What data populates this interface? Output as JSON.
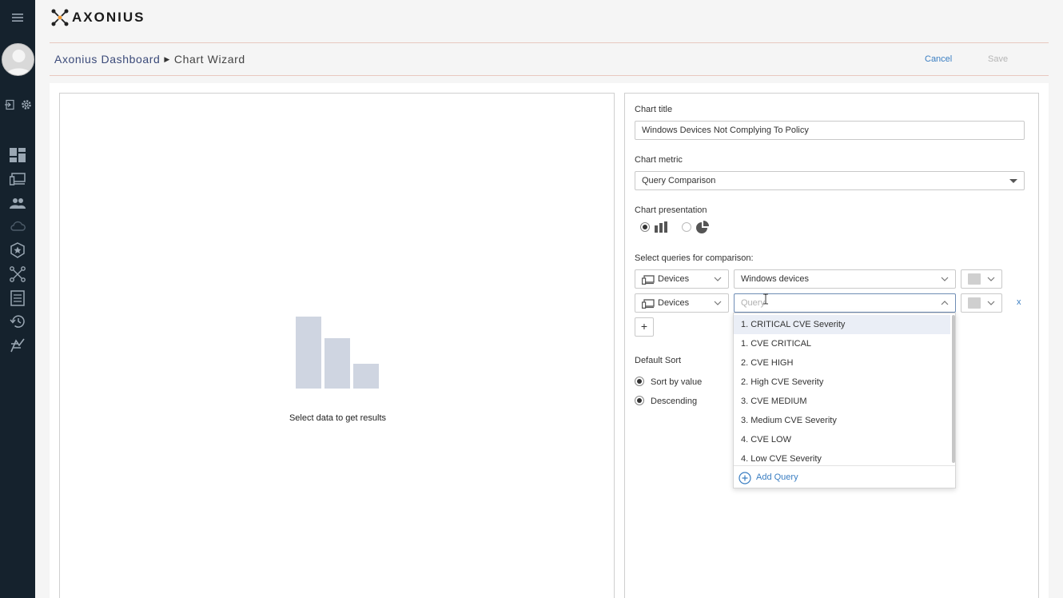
{
  "app": {
    "logo_text": "AXONIUS"
  },
  "breadcrumb": {
    "root": "Axonius Dashboard",
    "current": "Chart Wizard"
  },
  "header": {
    "cancel": "Cancel",
    "save": "Save"
  },
  "sidebar": {
    "items": [
      "menu-icon",
      "logout-icon",
      "settings-icon",
      "dashboard-icon",
      "devices-icon",
      "users-icon",
      "cloud-icon",
      "enforcement-icon",
      "adapters-icon",
      "reports-icon",
      "history-icon",
      "instances-icon"
    ]
  },
  "preview": {
    "empty_text": "Select data to get results"
  },
  "form": {
    "chart_title_label": "Chart title",
    "chart_title_value": "Windows Devices Not Complying To Policy",
    "chart_metric_label": "Chart metric",
    "chart_metric_value": "Query Comparison",
    "chart_presentation_label": "Chart presentation",
    "presentation_selected": "bar",
    "queries_label": "Select queries for comparison:",
    "rows": [
      {
        "entity": "Devices",
        "query": "Windows devices",
        "placeholder": ""
      },
      {
        "entity": "Devices",
        "query": "",
        "placeholder": "Query"
      }
    ],
    "remove_label": "x",
    "add_label": "+",
    "default_sort_label": "Default Sort",
    "sort_by_value": "Sort by value",
    "descending": "Descending"
  },
  "dropdown": {
    "items": [
      "1. CRITICAL CVE Severity",
      "1. CVE CRITICAL",
      "2. CVE HIGH",
      "2. High CVE Severity",
      "3. CVE MEDIUM",
      "3. Medium CVE Severity",
      "4. CVE LOW",
      "4. Low CVE Severity"
    ],
    "add_query": "Add Query"
  },
  "colors": {
    "sidebar": "#15222d",
    "link": "#3a7ec2",
    "bars": "#cfd5e1",
    "breadcrumb_root": "#3b4a79"
  }
}
